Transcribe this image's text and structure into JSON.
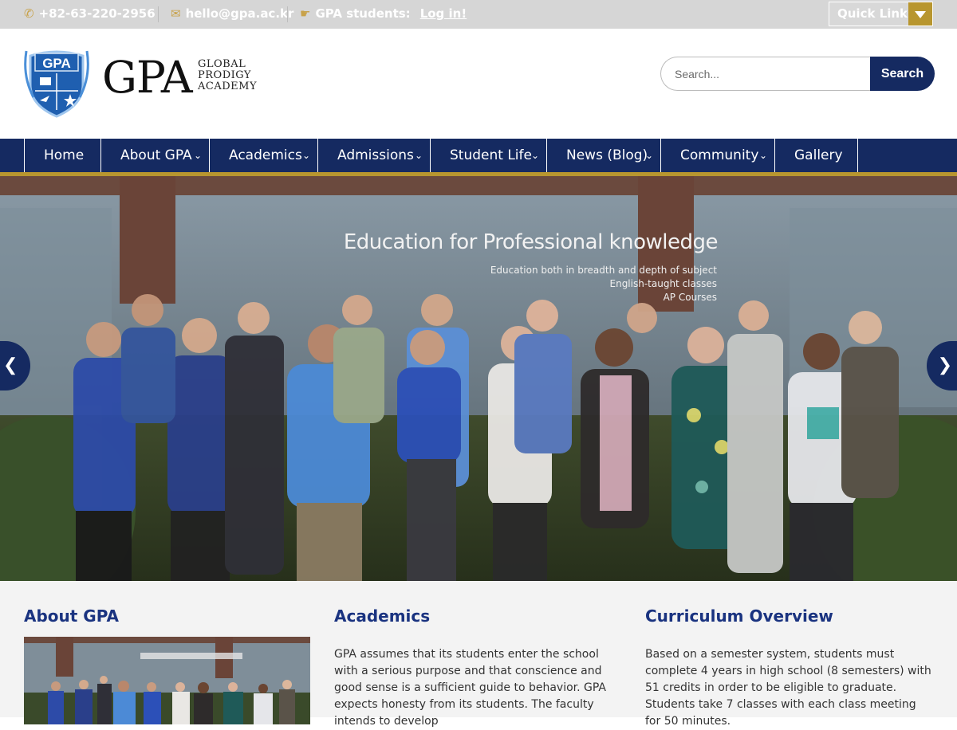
{
  "topbar": {
    "phone": "+82-63-220-2956",
    "email": "hello@gpa.ac.kr",
    "students_label": "GPA students:",
    "login_label": "Log in!",
    "quick_links": "Quick Links"
  },
  "header": {
    "crest_text": "GPA",
    "brand": "GPA",
    "brand_sub": [
      "GLOBAL",
      "PRODIGY",
      "ACADEMY"
    ],
    "search_placeholder": "Search...",
    "search_button": "Search"
  },
  "nav": {
    "items": [
      {
        "label": "Home"
      },
      {
        "label": "About GPA"
      },
      {
        "label": "Academics"
      },
      {
        "label": "Admissions"
      },
      {
        "label": "Student Life"
      },
      {
        "label": "News (Blog)"
      },
      {
        "label": "Community"
      },
      {
        "label": "Gallery"
      }
    ]
  },
  "hero": {
    "title": "Education for Professional knowledge",
    "lines": [
      "Education both in breadth and depth of subject",
      "English-taught classes",
      "AP Courses"
    ]
  },
  "columns": {
    "about": {
      "title": "About GPA"
    },
    "academics": {
      "title": "Academics",
      "text": "GPA assumes that its students enter the school with a serious purpose and that conscience and good sense is a sufficient guide to behavior. GPA expects honesty from its students. The faculty intends to develop"
    },
    "curriculum": {
      "title": "Curriculum Overview",
      "text": "Based on a semester system, students must complete 4 years in high school (8 semesters) with 51 credits in order to be eligible to graduate. Students take 7 classes with each class meeting for 50 minutes."
    }
  },
  "colors": {
    "navy": "#152a61",
    "gold": "#b8962f",
    "link_blue": "#1a3380",
    "topbar_bg": "#d6d6d6"
  }
}
